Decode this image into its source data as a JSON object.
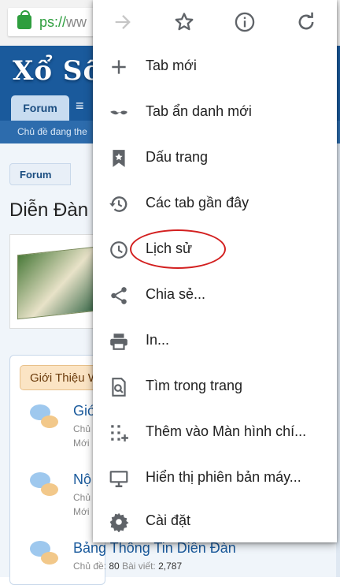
{
  "browser": {
    "url_scheme": "ps://",
    "url_rest": "ww"
  },
  "site": {
    "logo": "Xổ Số",
    "forum_tab": "Forum",
    "subnav_text": "Chủ đề đang the",
    "breadcrumb": "Forum",
    "page_title": "Diễn Đàn",
    "category_head": "Giới Thiệu W",
    "forums": [
      {
        "title": "Giớ",
        "meta1": "Chủ",
        "meta2": "Mới"
      },
      {
        "title": "Nộ",
        "meta1": "Chủ",
        "meta2": "Mới"
      }
    ],
    "bottom_forum": {
      "title": "Bảng Thông Tin Diễn Đàn",
      "threads_label": "Chủ đề:",
      "threads": "80",
      "posts_label": "Bài viết:",
      "posts": "2,787"
    }
  },
  "menu": {
    "top_icons": [
      "forward-arrow-icon",
      "star-icon",
      "info-icon",
      "reload-icon"
    ],
    "items": [
      {
        "label": "Tab mới",
        "icon": "plus-icon"
      },
      {
        "label": "Tab ẩn danh mới",
        "icon": "incognito-icon"
      },
      {
        "label": "Dấu trang",
        "icon": "bookmark-star-icon"
      },
      {
        "label": "Các tab gần đây",
        "icon": "history-restore-icon"
      },
      {
        "label": "Lịch sử",
        "icon": "clock-icon"
      },
      {
        "label": "Chia sẻ...",
        "icon": "share-icon"
      },
      {
        "label": "In...",
        "icon": "printer-icon"
      },
      {
        "label": "Tìm trong trang",
        "icon": "find-in-page-icon"
      },
      {
        "label": "Thêm vào Màn hình chí...",
        "icon": "add-to-home-icon"
      },
      {
        "label": "Hiển thị phiên bản máy...",
        "icon": "desktop-icon"
      },
      {
        "label": "Cài đặt",
        "icon": "gear-icon"
      }
    ]
  },
  "colors": {
    "header_blue": "#1a5a9c",
    "annotation_red": "#d32020",
    "icon_gray": "#5f6368"
  }
}
